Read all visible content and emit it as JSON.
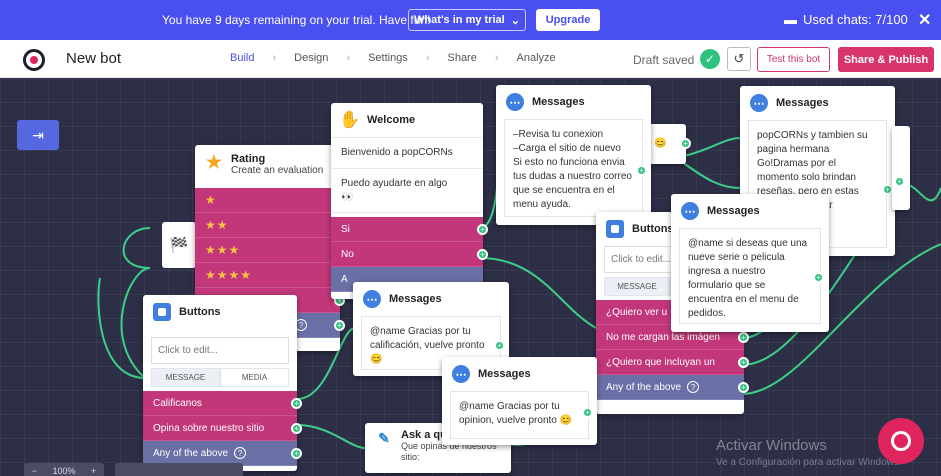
{
  "trial": {
    "text": "You have 9 days remaining on your trial. Have fun!",
    "whats_label": "What's in my trial",
    "upgrade_label": "Upgrade",
    "used_chats": "Used chats: 7/100",
    "close": "✕"
  },
  "header": {
    "bot_name": "New bot",
    "nav": [
      "Build",
      "Design",
      "Settings",
      "Share",
      "Analyze"
    ],
    "draft_status": "Draft saved",
    "test_label": "Test this bot",
    "publish_label": "Share & Publish"
  },
  "nodes": {
    "rating": {
      "title": "Rating",
      "subtitle": "Create an evaluation",
      "rows": [
        "★",
        "★★",
        "★★★",
        "★★★★"
      ]
    },
    "welcome": {
      "title": "Welcome",
      "text1": "Bienvenido a popCORNs",
      "text2": "Puedo ayudarte en algo",
      "text2b": "👀",
      "options": [
        "Si",
        "No"
      ]
    },
    "messages1": {
      "title": "Messages",
      "body": [
        "–Revisa tu conexion",
        "–Carga el sitio de nuevo",
        "Si esto no funciona envia tus dudas a nuestro correo que se encuentra en el menu ayuda."
      ]
    },
    "messages2": {
      "title": "Messages",
      "body": "popCORNs y tambien su pagina hermana Go!Dramas por el momento solo brindan reseñas, pero en estas podras encontrar"
    },
    "messages3": {
      "title": "Messages",
      "body": "@name si deseas que una nueve serie o pelicula ingresa a nuestro formulario que se encuentra en el menu de pedidos."
    },
    "messages4": {
      "title": "Messages",
      "body": "@name Gracias por tu calificación, vuelve pronto 😊"
    },
    "messages5": {
      "title": "Messages",
      "body": "@name Gracias por tu opinion, vuelve pronto 😊"
    },
    "buttons_left": {
      "title": "Buttons",
      "click_edit": "Click to edit...",
      "tabs": [
        "MESSAGE",
        "MEDIA"
      ],
      "rows": [
        "Calificanos",
        "Opina sobre nuestro sitio"
      ],
      "any": "Any of the above"
    },
    "buttons_right": {
      "title": "Buttons",
      "click_edit": "Click to edit...",
      "tab": "MESSAGE",
      "rows": [
        "¿Quiero ver u",
        "No me cargan las imágen",
        "¿Quiero que incluyan un"
      ],
      "any": "Any of the above"
    },
    "ask": {
      "title": "Ask a qu",
      "body": "Que opinas de nuestros sitio:"
    }
  },
  "watermark": {
    "line1": "Activar Windows",
    "line2": "Ve a Configuración para activar Windows."
  },
  "zoom": "100%"
}
